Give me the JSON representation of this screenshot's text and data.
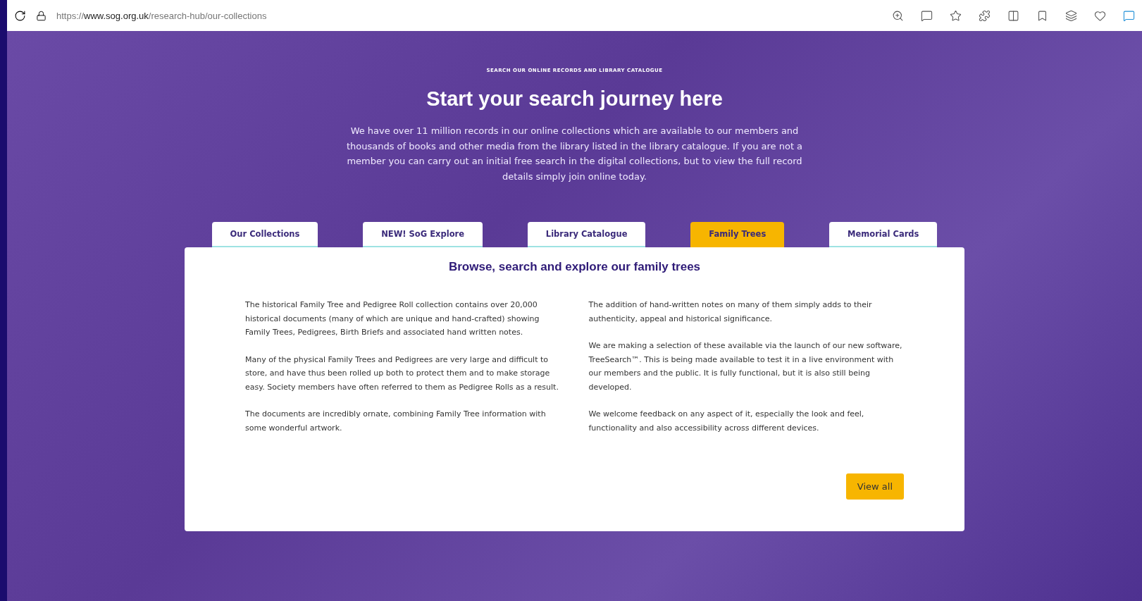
{
  "browser": {
    "url": "https://**www.sog.org.uk**/research-hub/our-collections"
  },
  "hero": {
    "eyebrow": "SEARCH OUR ONLINE RECORDS AND LIBRARY CATALOGUE",
    "title": "Start your search journey here",
    "intro": "We have over 11 million records in our online collections which are available to our members and thousands of books and other media from the library listed in the library catalogue. If you are not a member you can carry out an initial free search in the digital collections, but to view the full record details simply join online today."
  },
  "tabs": [
    {
      "label": "Our Collections",
      "selected": false
    },
    {
      "label": "NEW! SoG Explore",
      "selected": false
    },
    {
      "label": "Library Catalogue",
      "selected": false
    },
    {
      "label": "Family Trees",
      "selected": true
    },
    {
      "label": "Memorial Cards",
      "selected": false
    }
  ],
  "panel": {
    "title": "Browse, search and explore our family trees",
    "column_1": [
      "The historical Family Tree and Pedigree Roll collection contains over 20,000 historical documents (many of which are unique and hand-crafted) showing Family Trees, Pedigrees, Birth Briefs and associated hand written notes.",
      "Many of the physical Family Trees and Pedigrees are very large and difficult to store, and have thus been rolled up both to protect them and to make storage easy. Society members have often referred to them as Pedigree Rolls as a result.",
      "The documents are incredibly ornate, combining Family Tree information with some wonderful artwork."
    ],
    "column_2": [
      "The addition of hand-written notes on many of them simply adds to their authenticity, appeal and historical significance.",
      "We are making a selection of these available via the launch of our new software, TreeSearch™. This is being made available to test it in a live environment with our members and the public. It is fully functional, but it is also still being developed.",
      "We welcome feedback on any aspect of it, especially the look and feel, functionality and also accessibility across different devices."
    ],
    "button": "View all"
  }
}
